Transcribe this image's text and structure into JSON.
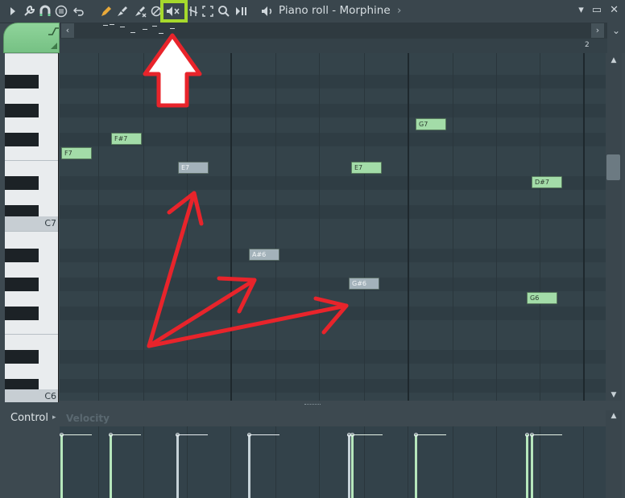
{
  "window": {
    "title": "Piano roll - Morphine",
    "title_chevron": "›",
    "buttons": [
      "▾",
      "▭",
      "✕"
    ]
  },
  "toolbar": {
    "icons": [
      "play-arrow",
      "wrench",
      "magnet",
      "menu-circle",
      "undo",
      "pencil",
      "paint-brush",
      "delete-brush",
      "mute-slash",
      "mute-speaker",
      "slice",
      "select",
      "zoom",
      "playback",
      "speaker"
    ]
  },
  "ruler": {
    "bar_number": "2"
  },
  "keyboard": {
    "labels": [
      "C7",
      "C6"
    ]
  },
  "notes": [
    {
      "label": "F7",
      "color": "green"
    },
    {
      "label": "F#7",
      "color": "green"
    },
    {
      "label": "E7",
      "color": "grey"
    },
    {
      "label": "E7",
      "color": "green"
    },
    {
      "label": "G7",
      "color": "green"
    },
    {
      "label": "D#7",
      "color": "green"
    },
    {
      "label": "A#6",
      "color": "grey"
    },
    {
      "label": "G#6",
      "color": "grey"
    },
    {
      "label": "G6",
      "color": "green"
    }
  ],
  "control": {
    "label": "Control",
    "arrow": "▸",
    "parameter": "Velocity"
  },
  "colors": {
    "note_green": "#a3dca8",
    "note_grey": "#a3b2ba",
    "highlight": "#a6d92c",
    "annotation": "#e8242b"
  }
}
